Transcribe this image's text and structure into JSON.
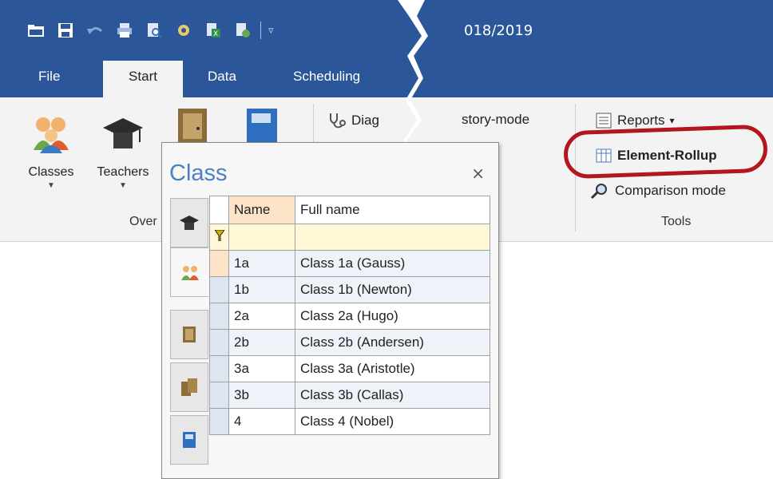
{
  "window": {
    "title_fragment": "018/2019"
  },
  "ribbon_tabs": [
    {
      "label": "File"
    },
    {
      "label": "Start",
      "active": true
    },
    {
      "label": "Data"
    },
    {
      "label": "Scheduling"
    }
  ],
  "ribbon": {
    "classes_label": "Classes",
    "teachers_label": "Teachers",
    "overview_group_label": "Over",
    "diagnosis_label": "Diag",
    "history_label": "story-mode",
    "reports_label": "Reports",
    "element_rollup_label": "Element-Rollup",
    "comparison_label": "Comparison mode",
    "tools_group_label": "Tools"
  },
  "dialog": {
    "title": "Class",
    "close_glyph": "×",
    "columns": {
      "name": "Name",
      "full_name": "Full name"
    },
    "rows": [
      {
        "name": "1a",
        "full": "Class 1a (Gauss)"
      },
      {
        "name": "1b",
        "full": "Class 1b (Newton)"
      },
      {
        "name": "2a",
        "full": "Class 2a (Hugo)"
      },
      {
        "name": "2b",
        "full": "Class 2b (Andersen)"
      },
      {
        "name": "3a",
        "full": "Class 3a (Aristotle)"
      },
      {
        "name": "3b",
        "full": "Class 3b (Callas)"
      },
      {
        "name": "4",
        "full": "Class 4 (Nobel)"
      }
    ]
  },
  "colors": {
    "ribbon_blue": "#2b579a",
    "title_blue": "#4d80c2",
    "highlight_red": "#b3161c"
  }
}
